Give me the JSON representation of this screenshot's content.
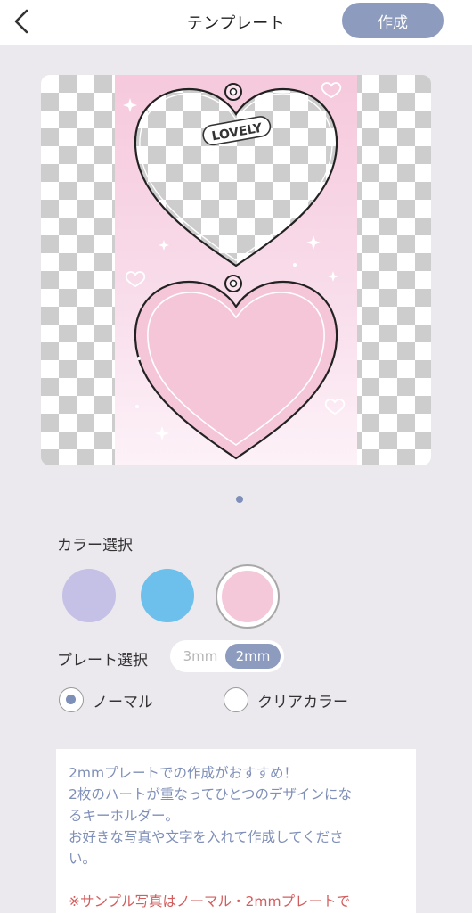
{
  "header": {
    "back_icon": "chevron-left-icon",
    "title": "テンプレート",
    "create_label": "作成"
  },
  "preview": {
    "sticker_text": "LOVELY",
    "page_count": 1,
    "current_page": 1
  },
  "color_select": {
    "label": "カラー選択",
    "options": [
      {
        "name": "lavender",
        "color": "#c4c0e6",
        "selected": false
      },
      {
        "name": "sky-blue",
        "color": "#6cc0eb",
        "selected": false
      },
      {
        "name": "pink",
        "color": "#f4c8d8",
        "selected": true
      }
    ]
  },
  "plate_select": {
    "label": "プレート選択",
    "options": [
      {
        "label": "3mm",
        "selected": false
      },
      {
        "label": "2mm",
        "selected": true
      }
    ]
  },
  "finish_select": {
    "options": [
      {
        "label": "ノーマル",
        "selected": true
      },
      {
        "label": "クリアカラー",
        "selected": false
      }
    ]
  },
  "info": {
    "lines": [
      "2mmプレートでの作成がおすすめ！",
      "2枚のハートが重なってひとつのデザインにな",
      "るキーホルダー。",
      "お好きな写真や文字を入れて作成してくださ",
      "い。"
    ],
    "warning": "※サンプル写真はノーマル・2mmプレートで"
  },
  "colors": {
    "accent": "#8d9bbe",
    "info_text": "#7f8fb8",
    "warning_text": "#d35d5d"
  }
}
